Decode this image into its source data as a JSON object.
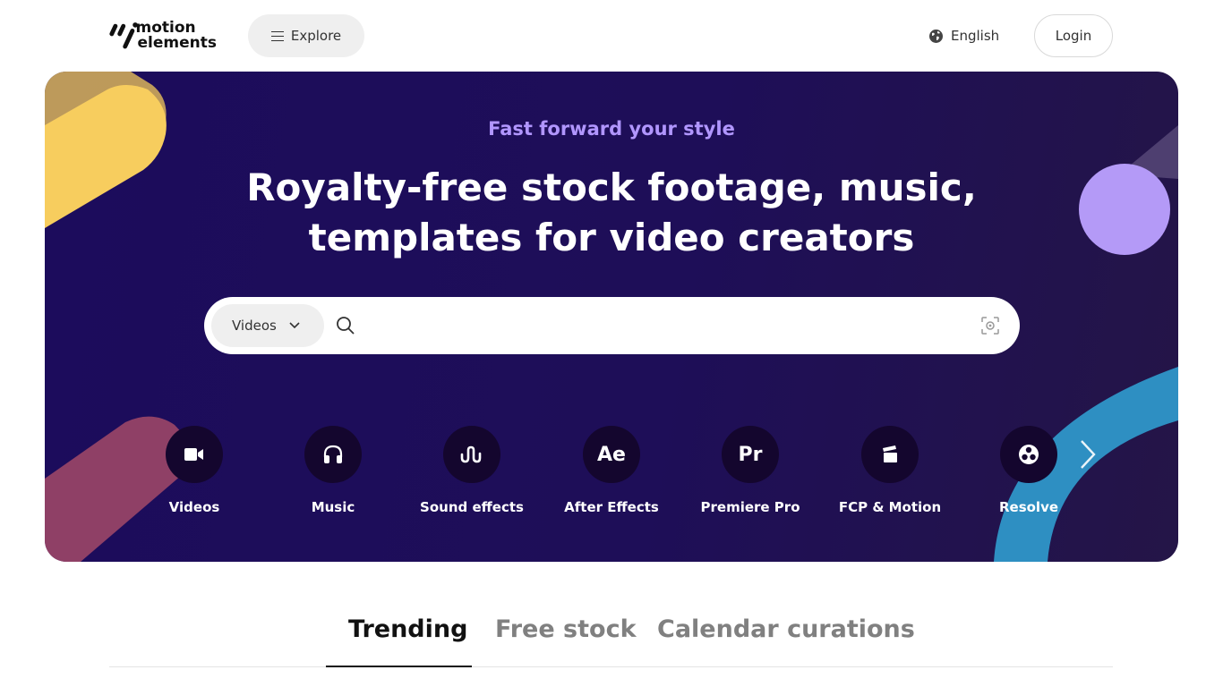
{
  "brand": {
    "line1": "motion",
    "line2": "elements"
  },
  "header": {
    "explore_label": "Explore",
    "language_label": "English",
    "login_label": "Login"
  },
  "hero": {
    "tagline": "Fast forward your style",
    "headline_line1": "Royalty-free stock footage, music,",
    "headline_line2": "templates for video creators",
    "colors": {
      "tagline": "#b196ff",
      "background": "#1c0c5c",
      "accent_yellow": "#f7cd5e",
      "accent_purple": "#b49af7",
      "accent_blue": "#2e8fc2"
    }
  },
  "search": {
    "category_selected": "Videos",
    "placeholder": "",
    "icons": {
      "search": "search-icon",
      "visual_search": "visual-search-icon",
      "dropdown": "chevron-down-icon"
    }
  },
  "categories": [
    {
      "label": "Videos",
      "icon": "video-camera-icon"
    },
    {
      "label": "Music",
      "icon": "headphones-icon"
    },
    {
      "label": "Sound effects",
      "icon": "sound-wave-icon"
    },
    {
      "label": "After Effects",
      "icon": "after-effects-icon",
      "glyph": "Ae"
    },
    {
      "label": "Premiere Pro",
      "icon": "premiere-pro-icon",
      "glyph": "Pr"
    },
    {
      "label": "FCP & Motion",
      "icon": "clapperboard-icon"
    },
    {
      "label": "Resolve",
      "icon": "resolve-icon"
    }
  ],
  "tabs": [
    {
      "label": "Trending",
      "active": true
    },
    {
      "label": "Free stock",
      "active": false
    },
    {
      "label": "Calendar curations",
      "active": false
    }
  ]
}
